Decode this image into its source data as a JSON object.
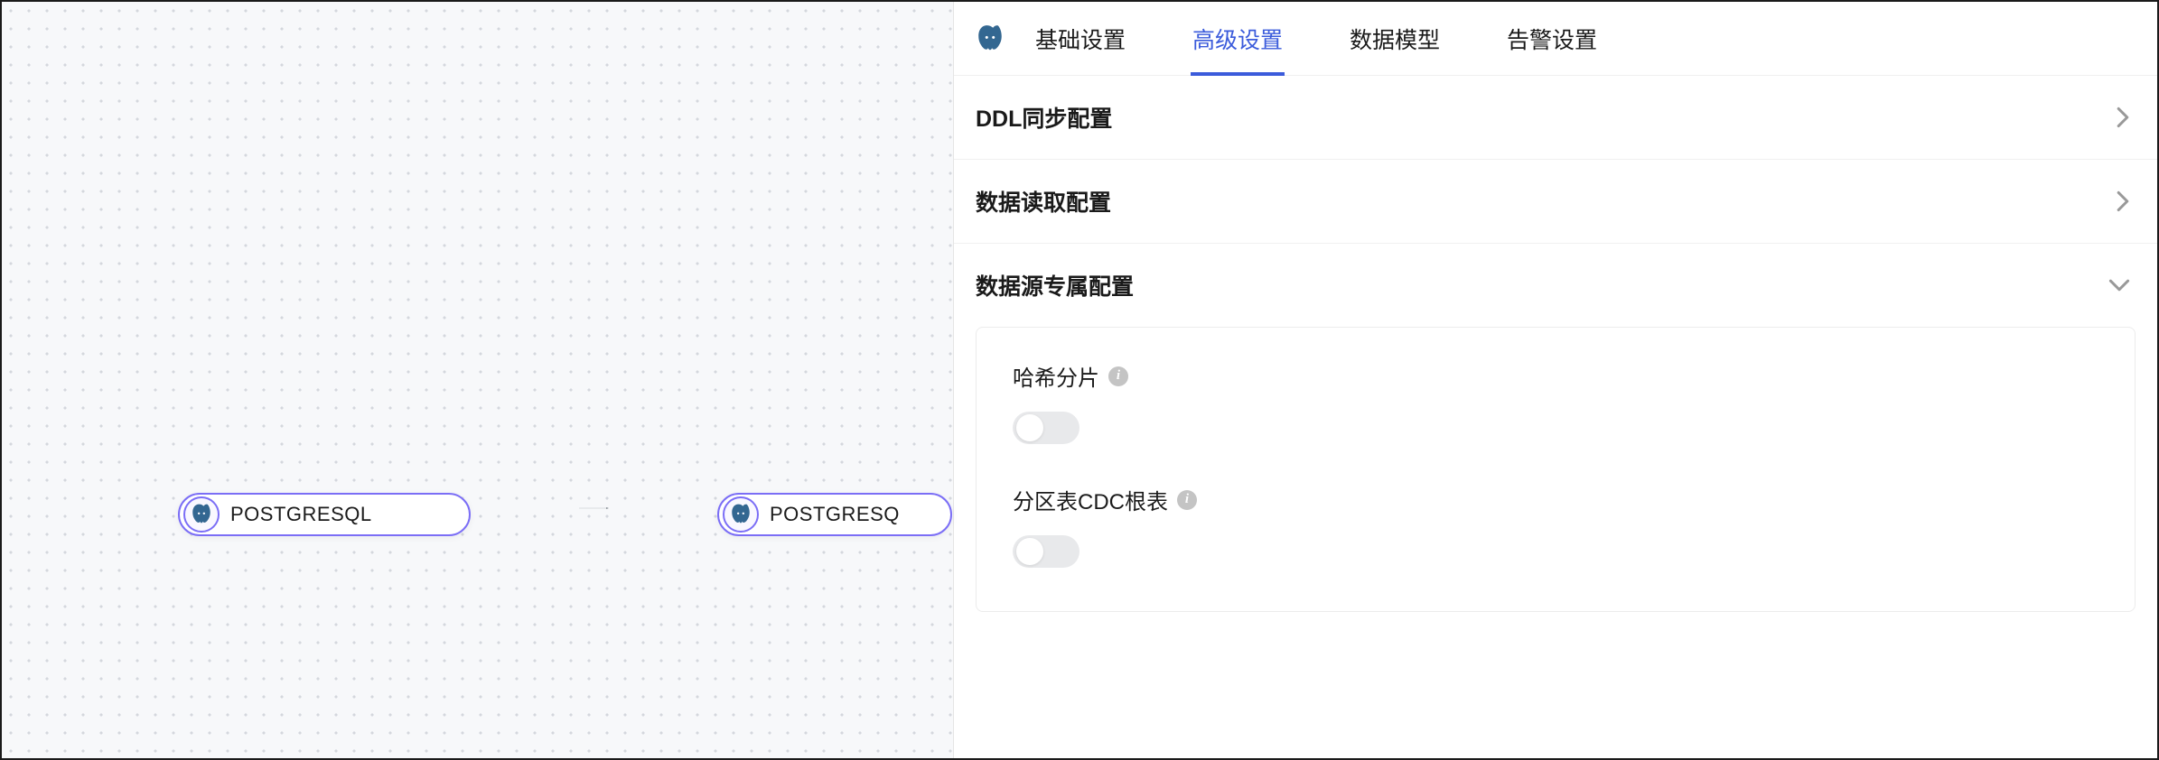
{
  "canvas": {
    "nodes": [
      {
        "label": "POSTGRESQL"
      },
      {
        "label": "POSTGRESQ"
      }
    ]
  },
  "tabs": [
    {
      "label": "基础设置",
      "active": false
    },
    {
      "label": "高级设置",
      "active": true
    },
    {
      "label": "数据模型",
      "active": false
    },
    {
      "label": "告警设置",
      "active": false
    }
  ],
  "sections": {
    "ddl": {
      "title": "DDL同步配置",
      "expanded": false
    },
    "read": {
      "title": "数据读取配置",
      "expanded": false
    },
    "datasource": {
      "title": "数据源专属配置",
      "expanded": true,
      "settings": {
        "hash": {
          "label": "哈希分片",
          "enabled": false
        },
        "cdc": {
          "label": "分区表CDC根表",
          "enabled": false
        }
      }
    }
  }
}
